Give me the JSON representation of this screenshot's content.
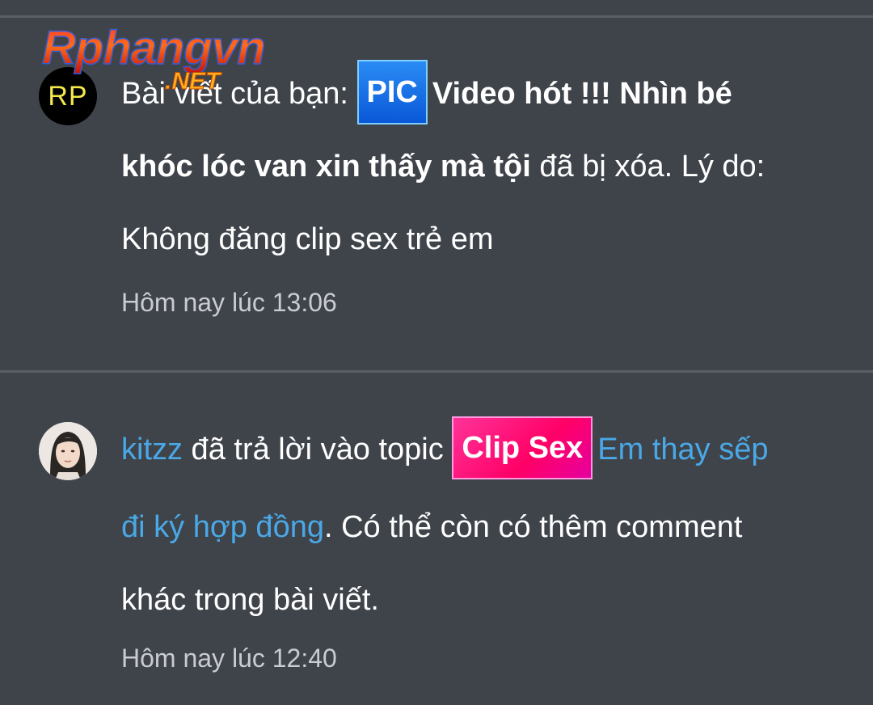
{
  "logo": {
    "main": "Rphangvn",
    "sub": ".NET"
  },
  "notifications": [
    {
      "avatar_text": "RP",
      "prefix": "Bài viết của bạn:",
      "tag": "PIC",
      "title_line1": "Video hót !!! Nhìn bé",
      "title_line2": "khóc lóc van xin thấy mà tội",
      "suffix_line2": " đã bị xóa. Lý do:",
      "line3": "Không đăng clip sex trẻ em",
      "time": "Hôm nay lúc 13:06"
    },
    {
      "user": "kitzz",
      "action": " đã trả lời vào topic ",
      "tag": "Clip Sex",
      "link_line1": "Em thay sếp",
      "link_line2": "đi ký hợp đồng",
      "rest_line2": ". Có thể còn có thêm comment",
      "line3": "khác trong bài viết.",
      "time": "Hôm nay lúc 12:40"
    }
  ],
  "colors": {
    "background": "#3f434a",
    "divider": "#5a5e65",
    "link": "#4aa8e6",
    "timestamp": "#c9ccd1",
    "pic_tag": "#0a58d8",
    "clip_tag": "#ff0066"
  }
}
